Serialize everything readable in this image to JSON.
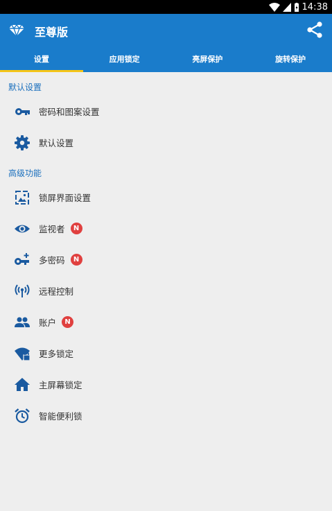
{
  "status_bar": {
    "time": "14:38"
  },
  "app_bar": {
    "title": "至尊版"
  },
  "tabs": [
    {
      "label": "设置",
      "active": true
    },
    {
      "label": "应用锁定",
      "active": false
    },
    {
      "label": "亮屏保护",
      "active": false
    },
    {
      "label": "旋转保护",
      "active": false
    }
  ],
  "sections": [
    {
      "header": "默认设置",
      "items": [
        {
          "label": "密码和图案设置",
          "icon": "key-icon"
        },
        {
          "label": "默认设置",
          "icon": "gear-icon"
        }
      ]
    },
    {
      "header": "高级功能",
      "items": [
        {
          "label": "锁屏界面设置",
          "icon": "wallpaper-icon"
        },
        {
          "label": "监视者",
          "icon": "eye-icon",
          "badge": "N"
        },
        {
          "label": "多密码",
          "icon": "multi-key-icon",
          "badge": "N"
        },
        {
          "label": "远程控制",
          "icon": "wireless-icon"
        },
        {
          "label": "账户",
          "icon": "people-icon",
          "badge": "N"
        },
        {
          "label": "更多锁定",
          "icon": "wifi-lock-icon"
        },
        {
          "label": "主屏幕锁定",
          "icon": "home-icon"
        },
        {
          "label": "智能便利锁",
          "icon": "alarm-icon"
        }
      ]
    }
  ],
  "colors": {
    "primary": "#1a7ccb",
    "accent": "#f5c518",
    "badge": "#e0403f",
    "section_header": "#1a6fbd",
    "icon": "#1a5aa0"
  }
}
